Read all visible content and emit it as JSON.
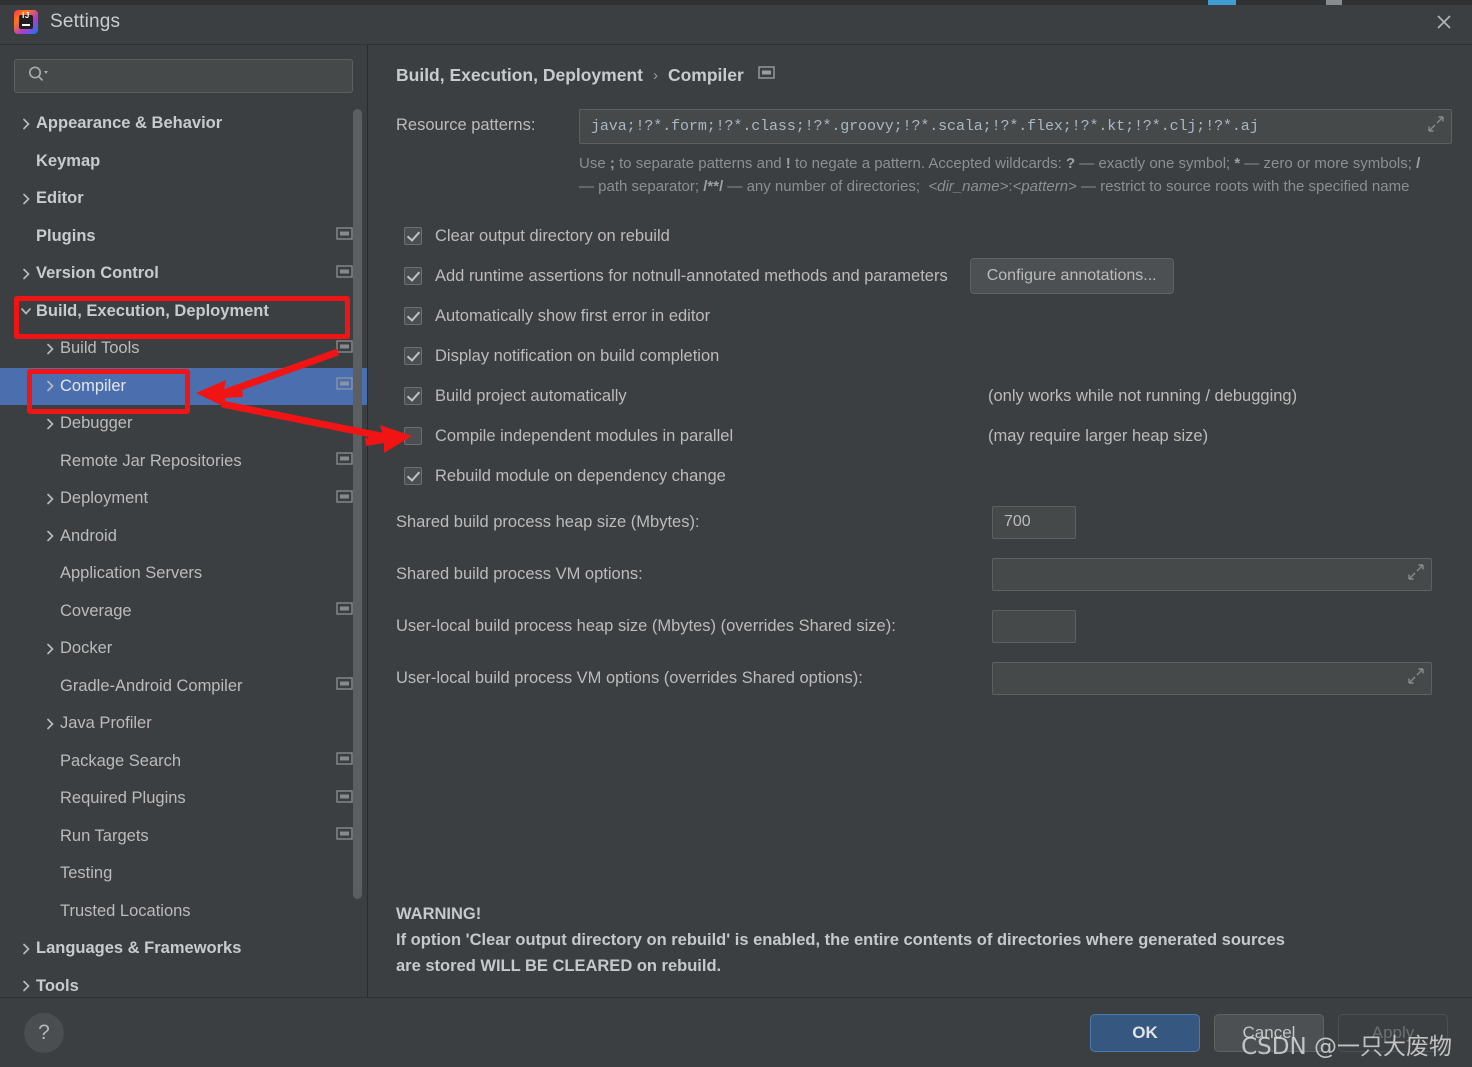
{
  "window": {
    "title": "Settings",
    "app_icon": "intellij-idea-logo",
    "close_icon": "close-icon"
  },
  "sidebar": {
    "search": {
      "placeholder": "",
      "value": "",
      "icon": "search-icon"
    },
    "items": [
      {
        "label": "Appearance & Behavior",
        "level": 0,
        "arrow": "chevron-right",
        "bold": true,
        "badge": false,
        "selected": false
      },
      {
        "label": "Keymap",
        "level": 0,
        "arrow": "none",
        "bold": true,
        "badge": false,
        "selected": false
      },
      {
        "label": "Editor",
        "level": 0,
        "arrow": "chevron-right",
        "bold": true,
        "badge": false,
        "selected": false
      },
      {
        "label": "Plugins",
        "level": 0,
        "arrow": "none",
        "bold": true,
        "badge": true,
        "selected": false
      },
      {
        "label": "Version Control",
        "level": 0,
        "arrow": "chevron-right",
        "bold": true,
        "badge": true,
        "selected": false
      },
      {
        "label": "Build, Execution, Deployment",
        "level": 0,
        "arrow": "chevron-down",
        "bold": true,
        "badge": false,
        "selected": false
      },
      {
        "label": "Build Tools",
        "level": 1,
        "arrow": "chevron-right",
        "bold": false,
        "badge": true,
        "selected": false
      },
      {
        "label": "Compiler",
        "level": 1,
        "arrow": "chevron-right",
        "bold": false,
        "badge": true,
        "selected": true
      },
      {
        "label": "Debugger",
        "level": 1,
        "arrow": "chevron-right",
        "bold": false,
        "badge": false,
        "selected": false
      },
      {
        "label": "Remote Jar Repositories",
        "level": 1,
        "arrow": "none",
        "bold": false,
        "badge": true,
        "selected": false
      },
      {
        "label": "Deployment",
        "level": 1,
        "arrow": "chevron-right",
        "bold": false,
        "badge": true,
        "selected": false
      },
      {
        "label": "Android",
        "level": 1,
        "arrow": "chevron-right",
        "bold": false,
        "badge": false,
        "selected": false
      },
      {
        "label": "Application Servers",
        "level": 1,
        "arrow": "none",
        "bold": false,
        "badge": false,
        "selected": false
      },
      {
        "label": "Coverage",
        "level": 1,
        "arrow": "none",
        "bold": false,
        "badge": true,
        "selected": false
      },
      {
        "label": "Docker",
        "level": 1,
        "arrow": "chevron-right",
        "bold": false,
        "badge": false,
        "selected": false
      },
      {
        "label": "Gradle-Android Compiler",
        "level": 1,
        "arrow": "none",
        "bold": false,
        "badge": true,
        "selected": false
      },
      {
        "label": "Java Profiler",
        "level": 1,
        "arrow": "chevron-right",
        "bold": false,
        "badge": false,
        "selected": false
      },
      {
        "label": "Package Search",
        "level": 1,
        "arrow": "none",
        "bold": false,
        "badge": true,
        "selected": false
      },
      {
        "label": "Required Plugins",
        "level": 1,
        "arrow": "none",
        "bold": false,
        "badge": true,
        "selected": false
      },
      {
        "label": "Run Targets",
        "level": 1,
        "arrow": "none",
        "bold": false,
        "badge": true,
        "selected": false
      },
      {
        "label": "Testing",
        "level": 1,
        "arrow": "none",
        "bold": false,
        "badge": false,
        "selected": false
      },
      {
        "label": "Trusted Locations",
        "level": 1,
        "arrow": "none",
        "bold": false,
        "badge": false,
        "selected": false
      },
      {
        "label": "Languages & Frameworks",
        "level": 0,
        "arrow": "chevron-right",
        "bold": true,
        "badge": false,
        "selected": false
      },
      {
        "label": "Tools",
        "level": 0,
        "arrow": "chevron-right",
        "bold": true,
        "badge": false,
        "selected": false
      }
    ]
  },
  "header": {
    "breadcrumb_root": "Build, Execution, Deployment",
    "breadcrumb_separator": "›",
    "breadcrumb_leaf": "Compiler",
    "project_scope_icon": "project-scope-icon",
    "back_icon": "arrow-left-icon",
    "forward_icon": "arrow-right-icon"
  },
  "main": {
    "resource_patterns": {
      "label": "Resource patterns:",
      "value": "java;!?*.form;!?*.class;!?*.groovy;!?*.scala;!?*.flex;!?*.kt;!?*.clj;!?*.aj",
      "expand_icon": "expand-editor-icon"
    },
    "hint_line1_a": "Use ",
    "hint": "Use ; to separate patterns and ! to negate a pattern. Accepted wildcards: ? — exactly one symbol; * — zero or more symbols; / — path separator; /**/ — any number of directories; <dir_name>:<pattern> — restrict to source roots with the specified name",
    "checkboxes": [
      {
        "label": "Clear output directory on rebuild",
        "checked": true,
        "note": "",
        "button": ""
      },
      {
        "label": "Add runtime assertions for notnull-annotated methods and parameters",
        "checked": true,
        "note": "",
        "button": "Configure annotations..."
      },
      {
        "label": "Automatically show first error in editor",
        "checked": true,
        "note": "",
        "button": ""
      },
      {
        "label": "Display notification on build completion",
        "checked": true,
        "note": "",
        "button": ""
      },
      {
        "label": "Build project automatically",
        "checked": true,
        "note": "(only works while not running / debugging)",
        "button": ""
      },
      {
        "label": "Compile independent modules in parallel",
        "checked": false,
        "note": "(may require larger heap size)",
        "button": ""
      },
      {
        "label": "Rebuild module on dependency change",
        "checked": true,
        "note": "",
        "button": ""
      }
    ],
    "fields": [
      {
        "label": "Shared build process heap size (Mbytes):",
        "value": "700",
        "kind": "number"
      },
      {
        "label": "Shared build process VM options:",
        "value": "",
        "kind": "text"
      },
      {
        "label": "User-local build process heap size (Mbytes) (overrides Shared size):",
        "value": "",
        "kind": "number"
      },
      {
        "label": "User-local build process VM options (overrides Shared options):",
        "value": "",
        "kind": "text"
      }
    ],
    "warning_title": "WARNING!",
    "warning_line1": "If option 'Clear output directory on rebuild' is enabled, the entire contents of directories where generated sources",
    "warning_line2": "are stored WILL BE CLEARED on rebuild."
  },
  "footer": {
    "help_label": "?",
    "ok": "OK",
    "cancel": "Cancel",
    "apply": "Apply"
  },
  "watermark": "CSDN @一只大废物",
  "colors": {
    "background": "#3c3f41",
    "selection": "#4b6eaf",
    "primary_button": "#365880",
    "annotation_red": "#f11414",
    "text": "#bbbbbb",
    "code_text": "#a9b7c6"
  }
}
